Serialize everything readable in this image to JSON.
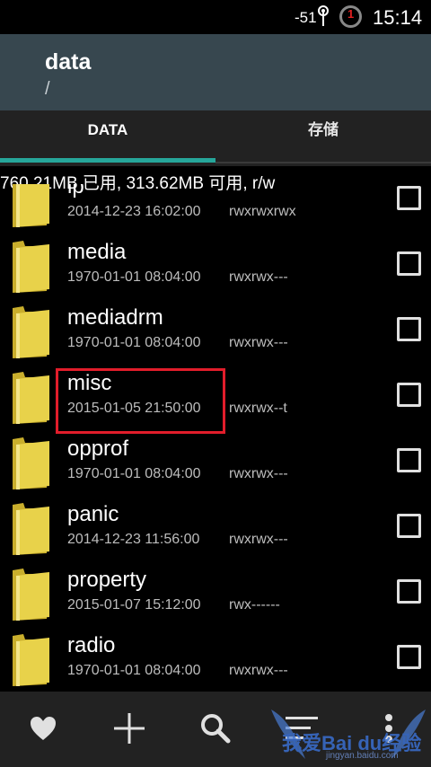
{
  "status_bar": {
    "signal": "-51",
    "notification_count": "1",
    "time": "15:14"
  },
  "header": {
    "title": "data",
    "path": "/"
  },
  "tabs": [
    {
      "label": "DATA",
      "active": true
    },
    {
      "label": "存储",
      "active": false
    }
  ],
  "storage_info": "760.21MB 已用, 313.62MB 可用, r/w",
  "files": [
    {
      "name": "lp",
      "date": "2014-12-23 16:02:00",
      "perm": "rwxrwxrwx"
    },
    {
      "name": "media",
      "date": "1970-01-01 08:04:00",
      "perm": "rwxrwx---"
    },
    {
      "name": "mediadrm",
      "date": "1970-01-01 08:04:00",
      "perm": "rwxrwx---"
    },
    {
      "name": "misc",
      "date": "2015-01-05 21:50:00",
      "perm": "rwxrwx--t"
    },
    {
      "name": "opprof",
      "date": "1970-01-01 08:04:00",
      "perm": "rwxrwx---"
    },
    {
      "name": "panic",
      "date": "2014-12-23 11:56:00",
      "perm": "rwxrwx---"
    },
    {
      "name": "property",
      "date": "2015-01-07 15:12:00",
      "perm": "rwx------"
    },
    {
      "name": "radio",
      "date": "1970-01-01 08:04:00",
      "perm": "rwxrwx---"
    }
  ],
  "highlighted_file": "misc",
  "bottom_bar": [
    "heart-icon",
    "plus-icon",
    "search-icon",
    "sort-icon",
    "more-icon"
  ],
  "watermark": {
    "text": "我爱Bai du经验",
    "url": "jingyan.baidu.com"
  },
  "colors": {
    "header_bg": "#37474f",
    "tab_indicator": "#26a69a",
    "highlight_box": "#e21d2b",
    "folder": "#e8d24a"
  }
}
